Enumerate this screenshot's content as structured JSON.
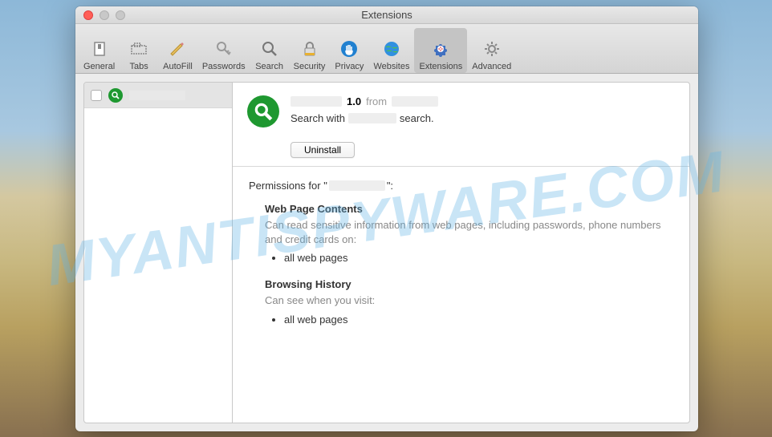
{
  "watermark": "MYANTISPYWARE.COM",
  "window": {
    "title": "Extensions"
  },
  "toolbar": {
    "items": [
      {
        "label": "General"
      },
      {
        "label": "Tabs"
      },
      {
        "label": "AutoFill"
      },
      {
        "label": "Passwords"
      },
      {
        "label": "Search"
      },
      {
        "label": "Security"
      },
      {
        "label": "Privacy"
      },
      {
        "label": "Websites"
      },
      {
        "label": "Extensions"
      },
      {
        "label": "Advanced"
      }
    ]
  },
  "extension": {
    "version": "1.0",
    "from_label": "from",
    "desc_prefix": "Search with",
    "desc_suffix": "search.",
    "uninstall_label": "Uninstall"
  },
  "permissions": {
    "title_prefix": "Permissions for \"",
    "title_suffix": "\":",
    "sections": [
      {
        "heading": "Web Page Contents",
        "desc": "Can read sensitive information from web pages, including passwords, phone numbers and credit cards on:",
        "items": [
          "all web pages"
        ]
      },
      {
        "heading": "Browsing History",
        "desc": "Can see when you visit:",
        "items": [
          "all web pages"
        ]
      }
    ]
  }
}
